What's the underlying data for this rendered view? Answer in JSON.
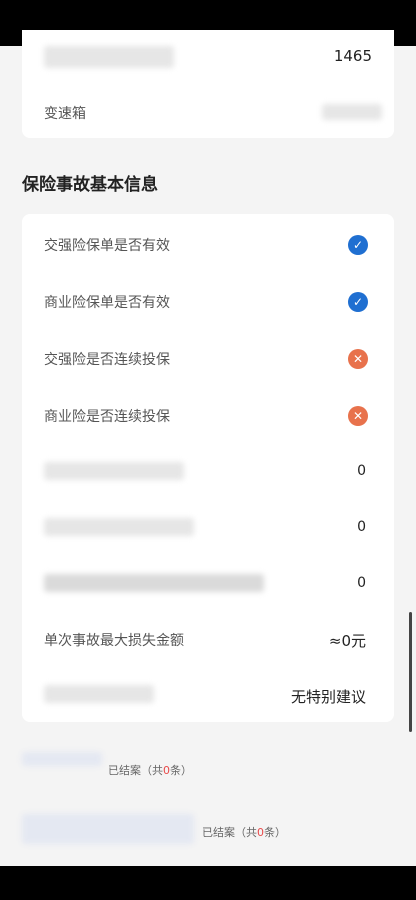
{
  "vehicle": {
    "engine_value": "1465",
    "gearbox_label": "变速箱"
  },
  "section": {
    "title": "保险事故基本信息"
  },
  "rows": [
    {
      "label": "交强险保单是否有效",
      "status": "valid"
    },
    {
      "label": "商业险保单是否有效",
      "status": "valid"
    },
    {
      "label": "交强险是否连续投保",
      "status": "invalid"
    },
    {
      "label": "商业险是否连续投保",
      "status": "invalid"
    }
  ],
  "blurred_values": [
    "0",
    "0",
    "0"
  ],
  "max_loss": {
    "label": "单次事故最大损失金额",
    "value": "≈0元"
  },
  "suggestion": {
    "value": "无特别建议"
  },
  "records": [
    {
      "prefix": "已结案（共",
      "count": "0",
      "suffix": "条）"
    },
    {
      "prefix": "已结案（共",
      "count": "0",
      "suffix": "条）"
    }
  ],
  "icons": {
    "valid": "check-circle-icon",
    "invalid": "cross-circle-icon"
  },
  "colors": {
    "valid": "#1f6fd1",
    "invalid": "#e8724c",
    "count": "#e84a4a"
  }
}
